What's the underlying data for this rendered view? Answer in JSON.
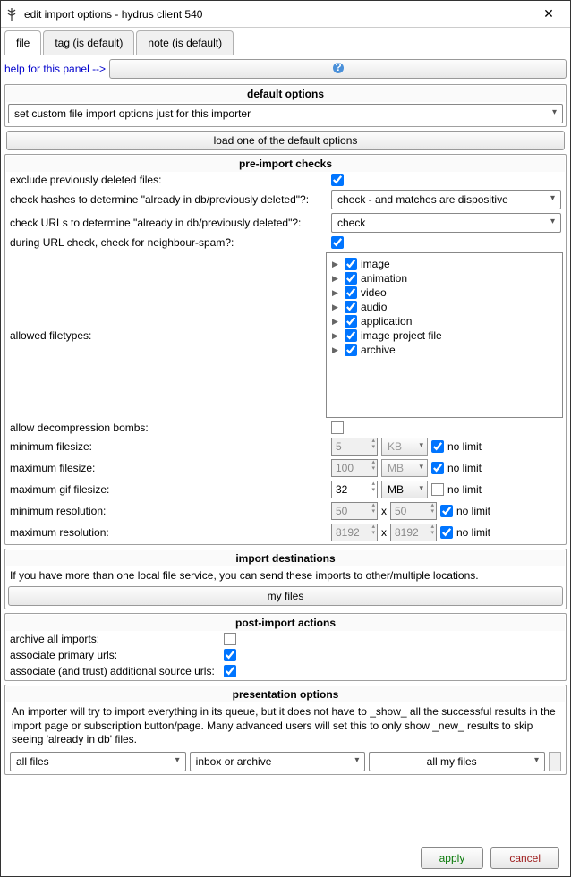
{
  "window": {
    "title": "edit import options - hydrus client 540"
  },
  "tabs": [
    {
      "label": "file"
    },
    {
      "label": "tag (is default)"
    },
    {
      "label": "note (is default)"
    }
  ],
  "help": {
    "label": "help for this panel -->",
    "icon": "help-icon"
  },
  "default_options": {
    "header": "default options",
    "combo": "set custom file import options just for this importer",
    "load_btn": "load one of the default options"
  },
  "preimport": {
    "header": "pre-import checks",
    "exclude_deleted": {
      "label": "exclude previously deleted files:",
      "checked": true
    },
    "check_hashes": {
      "label": "check hashes to determine \"already in db/previously deleted\"?:",
      "value": "check - and matches are dispositive"
    },
    "check_urls": {
      "label": "check URLs to determine \"already in db/previously deleted\"?:",
      "value": "check"
    },
    "neighbour": {
      "label": "during URL check, check for neighbour-spam?:",
      "checked": true
    },
    "filetypes_label": "allowed filetypes:",
    "filetype_items": [
      "image",
      "animation",
      "video",
      "audio",
      "application",
      "image project file",
      "archive"
    ],
    "allow_bombs": {
      "label": "allow decompression bombs:",
      "checked": false
    },
    "min_filesize": {
      "label": "minimum filesize:",
      "value": "5",
      "unit": "KB",
      "nolimit": true
    },
    "max_filesize": {
      "label": "maximum filesize:",
      "value": "100",
      "unit": "MB",
      "nolimit": true
    },
    "max_gif": {
      "label": "maximum gif filesize:",
      "value": "32",
      "unit": "MB",
      "nolimit": false
    },
    "min_res": {
      "label": "minimum resolution:",
      "w": "50",
      "h": "50",
      "nolimit": true
    },
    "max_res": {
      "label": "maximum resolution:",
      "w": "8192",
      "h": "8192",
      "nolimit": true
    },
    "nolimit_label": "no limit",
    "x_label": "x"
  },
  "destinations": {
    "header": "import destinations",
    "text": "If you have more than one local file service, you can send these imports to other/multiple locations.",
    "btn": "my files"
  },
  "postimport": {
    "header": "post-import actions",
    "archive_all": {
      "label": "archive all imports:",
      "checked": false
    },
    "assoc_primary": {
      "label": "associate primary urls:",
      "checked": true
    },
    "assoc_additional": {
      "label": "associate (and trust) additional source urls:",
      "checked": true
    }
  },
  "presentation": {
    "header": "presentation options",
    "text": "An importer will try to import everything in its queue, but it does not have to _show_ all the successful results in the import page or subscription button/page. Many advanced users will set this to only show _new_ results to skip seeing 'already in db' files.",
    "combo1": "all files",
    "combo2": "inbox or archive",
    "combo3": "all my files"
  },
  "footer": {
    "apply": "apply",
    "cancel": "cancel"
  }
}
